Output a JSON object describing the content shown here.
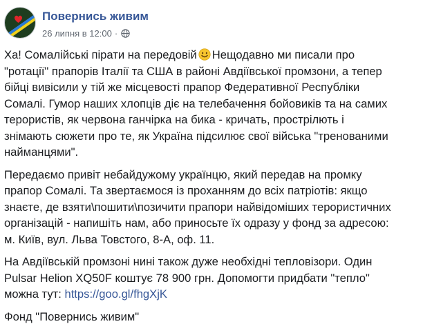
{
  "post": {
    "page_name": "Повернись живим",
    "date": "26 липня в 12:00",
    "dot": "·",
    "visibility_icon": "globe-icon",
    "avatar_icon": "heart-flag-icon",
    "paragraphs": [
      {
        "lines": [
          {
            "pre": "Ха! Сомалійські пірати на передовій",
            "emoji": "smile-emoji",
            "post": "Нещодавно ми писали про"
          },
          {
            "text": "\"ротації\" прапорів Італії та США в районі Авдіївської промзони, а тепер"
          },
          {
            "text": "бійці вивісили у тій же місцевості прапор Федеративної Республіки"
          },
          {
            "text": "Сомалі. Гумор наших хлопців діє на телебачення бойовиків та на самих"
          },
          {
            "text": "терористів, як червона ганчірка на бика - кричать, прострілють і"
          },
          {
            "text": "знімають сюжети про те, як Україна підсилює свої війська \"тренованими"
          },
          {
            "text": "найманцями\"."
          }
        ]
      },
      {
        "lines": [
          {
            "text": "Передаємо привіт небайдужому українцю, який передав на промку"
          },
          {
            "text": "прапор Сомалі. Та звертаємося із проханням до всіх патріотів: якщо"
          },
          {
            "text": "знаєте, де взяти\\пошити\\позичити прапори найвідоміших терористичних"
          },
          {
            "text": "організацій - напишіть нам, або приносьте їх одразу у фонд за адресою:"
          },
          {
            "text": "м. Київ, вул. Льва Товстого, 8-А, оф. 11."
          }
        ]
      },
      {
        "lines": [
          {
            "text": "На Авдіївській промзоні нині також дуже необхідні тепловізори. Один"
          },
          {
            "text": "Pulsar Helion XQ50F коштує 78 900 грн. Допомогти придбати \"тепло\""
          },
          {
            "pre": "можна тут: ",
            "link": "https://goo.gl/fhgXjK"
          }
        ]
      },
      {
        "lines": [
          {
            "text": "Фонд \"Повернись живим\""
          }
        ]
      }
    ]
  },
  "colors": {
    "link": "#385898",
    "text": "#1c1e21",
    "meta": "#606770",
    "avatar_bg": "#1e3d1f",
    "heart": "#e0252b",
    "stripe_blue": "#2b7bd6",
    "stripe_yellow": "#f2d21b"
  }
}
